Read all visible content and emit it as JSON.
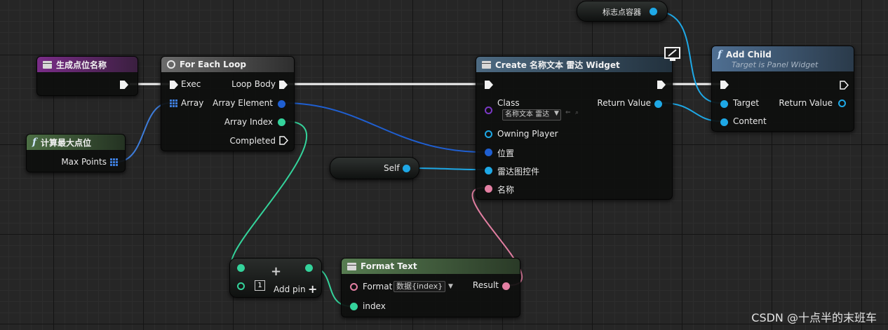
{
  "colors": {
    "exec": "#f2f2f2",
    "object": "#1ea8e6",
    "vector": "#1f5fd1",
    "int": "#34d39b",
    "text": "#e37fa2",
    "class": "#7a39c4",
    "header_event": "#6b2a7a",
    "header_loop": "#5f5f5f",
    "header_create": "#3d5366",
    "header_func_green": "#3d5b3a",
    "header_addchild": "#3f5a7a",
    "header_format": "#3d5b3a"
  },
  "node_generate": {
    "title": "生成点位名称",
    "icon": "event-icon"
  },
  "node_maxpoints": {
    "title": "计算最大点位",
    "icon": "function-icon",
    "out_label": "Max Points"
  },
  "node_foreach": {
    "title": "For Each Loop",
    "icon": "loop-icon",
    "in_exec": "Exec",
    "in_array": "Array",
    "out_loop_body": "Loop Body",
    "out_array_element": "Array Element",
    "out_array_index": "Array Index",
    "out_completed": "Completed"
  },
  "node_create": {
    "title": "Create 名称文本 雷达 Widget",
    "icon": "widget-icon",
    "class_label": "Class",
    "class_value": "名称文本 雷达",
    "owning_player": "Owning Player",
    "position": "位置",
    "radar": "雷达图控件",
    "name": "名称",
    "return_value": "Return Value"
  },
  "node_self": {
    "label": "Self"
  },
  "node_container": {
    "label": "标志点容器"
  },
  "node_addchild": {
    "title": "Add Child",
    "subtitle": "Target is Panel Widget",
    "icon": "function-icon",
    "target": "Target",
    "content": "Content",
    "return_value": "Return Value"
  },
  "node_append": {
    "index_value": "1",
    "add_pin": "Add pin",
    "plus": "+"
  },
  "node_format": {
    "title": "Format Text",
    "format_label": "Format",
    "format_value": "数据{index}",
    "result": "Result",
    "index": "index"
  },
  "watermark": "CSDN @十点半的末班车"
}
